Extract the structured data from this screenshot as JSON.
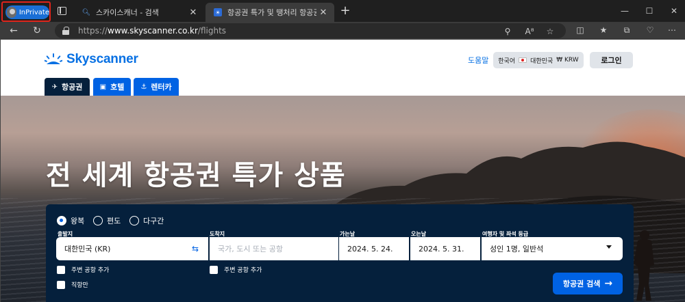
{
  "browser": {
    "inprivate_label": "InPrivate",
    "tabs": [
      {
        "title": "스카이스캐너 - 검색",
        "close": "✕"
      },
      {
        "title": "항공권 특가 및 땡처리 항공권 검",
        "close": "✕"
      }
    ],
    "new_tab": "+",
    "window_controls": [
      "—",
      "☐",
      "✕"
    ],
    "url": {
      "scheme": "https://",
      "host": "www.skyscanner.co.kr",
      "path": "/flights"
    },
    "icons": [
      "zoom-icon",
      "read-aloud-icon",
      "favorite-star-icon",
      "split-screen-icon",
      "favorites-icon",
      "collections-icon",
      "browser-essentials-icon"
    ]
  },
  "header": {
    "logo_text": "Skyscanner",
    "help": "도움말",
    "locale": {
      "language": "한국어",
      "country": "대한민국",
      "currency": "₩ KRW"
    },
    "login": "로그인"
  },
  "product_tabs": [
    {
      "label": "항공권",
      "icon": "plane-icon",
      "active": true
    },
    {
      "label": "호텔",
      "icon": "bed-icon",
      "active": false
    },
    {
      "label": "렌터카",
      "icon": "car-icon",
      "active": false
    }
  ],
  "hero": {
    "title": "전 세계 항공권 특가 상품"
  },
  "search": {
    "trip_types": [
      {
        "label": "왕복",
        "checked": true
      },
      {
        "label": "편도",
        "checked": false
      },
      {
        "label": "다구간",
        "checked": false
      }
    ],
    "from": {
      "label": "출발지",
      "value": "대한민국 (KR)"
    },
    "to": {
      "label": "도착지",
      "placeholder": "국가, 도시 또는 공항"
    },
    "depart": {
      "label": "가는날",
      "value": "2024. 5. 24."
    },
    "return": {
      "label": "오는날",
      "value": "2024. 5. 31."
    },
    "travellers": {
      "label": "여행자 및 좌석 등급",
      "value": "성인 1명, 일반석"
    },
    "nearby_from": "주변 공항 추가",
    "nearby_to": "주변 공항 추가",
    "direct_only": "직항만",
    "submit": "항공권 검색"
  },
  "colors": {
    "brand_blue": "#0062e3",
    "navy": "#05203c",
    "inprivate_highlight": "#e0241b"
  }
}
